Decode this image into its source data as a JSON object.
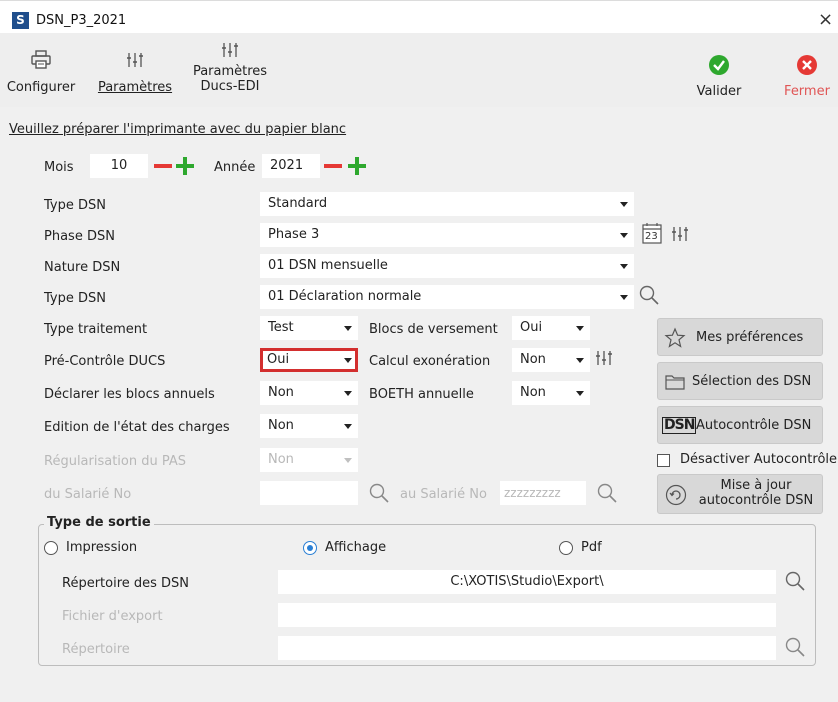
{
  "window": {
    "app_icon_letter": "S",
    "title": "DSN_P3_2021",
    "close": "×"
  },
  "toolbar": {
    "configurer": "Configurer",
    "parametres": "Paramètres",
    "parametres_ducs_line1": "Paramètres",
    "parametres_ducs_line2": "Ducs-EDI",
    "valider": "Valider",
    "fermer": "Fermer"
  },
  "notice": "Veuillez préparer l'imprimante avec du papier blanc",
  "period": {
    "mois_label": "Mois",
    "mois_value": "10",
    "annee_label": "Année",
    "annee_value": "2021"
  },
  "fields": {
    "type_dsn": {
      "label": "Type DSN",
      "value": "Standard"
    },
    "phase_dsn": {
      "label": "Phase DSN",
      "value": "Phase 3"
    },
    "nature_dsn": {
      "label": "Nature DSN",
      "value": "01 DSN mensuelle"
    },
    "type_dsn2": {
      "label": "Type DSN",
      "value": "01 Déclaration normale"
    },
    "type_traitement": {
      "label": "Type traitement",
      "value": "Test"
    },
    "blocs_versement": {
      "label": "Blocs de versement",
      "value": "Oui"
    },
    "pre_controle": {
      "label": "Pré-Contrôle DUCS",
      "value": "Oui"
    },
    "calcul_exoneration": {
      "label": "Calcul exonération",
      "value": "Non"
    },
    "blocs_annuels": {
      "label": "Déclarer les blocs annuels",
      "value": "Non"
    },
    "boeth": {
      "label": "BOETH annuelle",
      "value": "Non"
    },
    "edition_charges": {
      "label": "Edition de l'état des charges",
      "value": "Non"
    },
    "regularisation": {
      "label": "Régularisation du PAS",
      "value": "Non"
    },
    "du_salarie": {
      "label": "du Salarié No",
      "value": ""
    },
    "au_salarie": {
      "label": "au Salarié No",
      "value": "zzzzzzzzz"
    }
  },
  "calendar_day": "23",
  "side_buttons": {
    "preferences": "Mes préférences",
    "selection": "Sélection des DSN",
    "autocontrole_logo": "DSN",
    "autocontrole": "Autocontrôle DSN",
    "desactiver": "Désactiver Autocontrôle",
    "maj_line1": "Mise à jour",
    "maj_line2": "autocontrôle DSN"
  },
  "output": {
    "title": "Type de sortie",
    "radio_impression": "Impression",
    "radio_affichage": "Affichage",
    "radio_pdf": "Pdf",
    "selected": "Affichage",
    "repertoire_dsn_label": "Répertoire des DSN",
    "repertoire_dsn_value": "C:\\XOTIS\\Studio\\Export\\",
    "fichier_export_label": "Fichier d'export",
    "fichier_export_value": "",
    "repertoire_label": "Répertoire",
    "repertoire_value": ""
  },
  "colors": {
    "accent_red": "#e53935",
    "accent_green": "#2ea82e",
    "highlight_border": "#d32f2f",
    "radio_blue": "#2a7fd4"
  }
}
